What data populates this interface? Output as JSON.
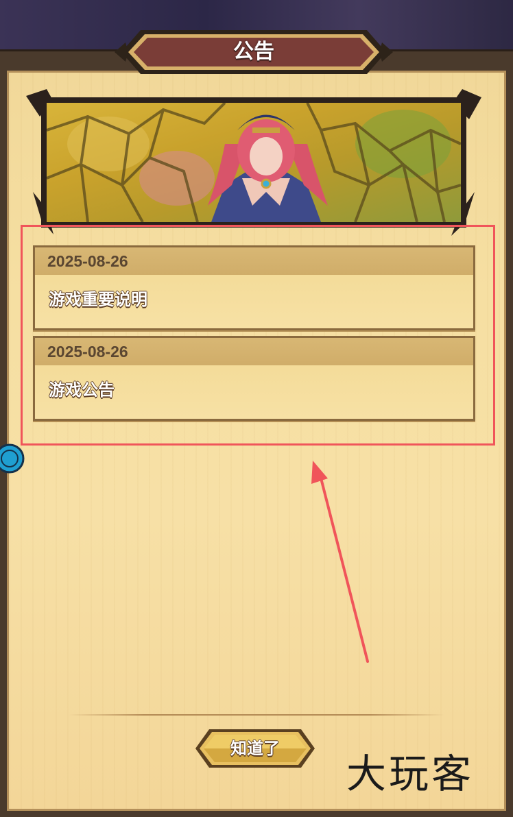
{
  "dialog": {
    "title": "公告",
    "ok_label": "知道了"
  },
  "notices": [
    {
      "date": "2025-08-26",
      "title": "游戏重要说明"
    },
    {
      "date": "2025-08-26",
      "title": "游戏公告"
    }
  ],
  "watermark": "大玩客",
  "colors": {
    "highlight": "#f0555a",
    "parchment": "#f6dfa2",
    "title_plate": "#7a3d37"
  }
}
